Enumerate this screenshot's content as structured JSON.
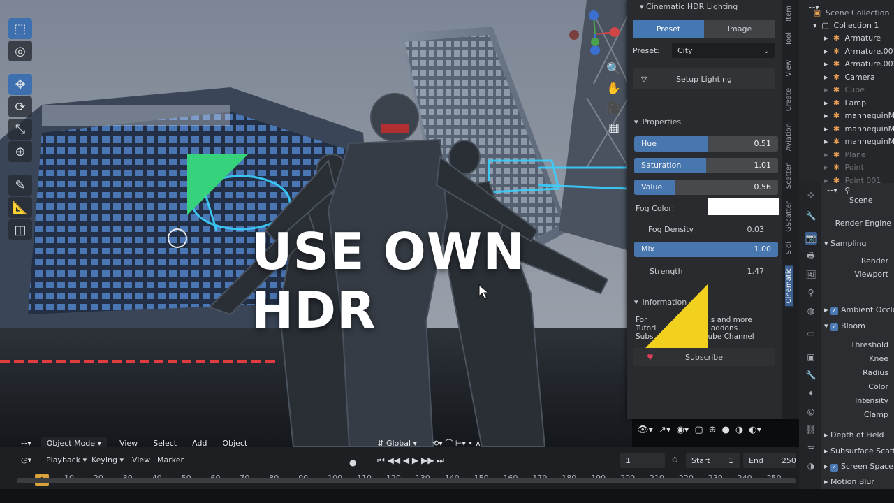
{
  "overlay_title": "USE OWN HDR",
  "viewport": {
    "mode": "Object Mode",
    "menus": [
      "View",
      "Select",
      "Add",
      "Object"
    ],
    "transform_orientation": "Global"
  },
  "npanel": {
    "title": "Cinematic HDR Lighting",
    "tabs": [
      "Preset",
      "Image"
    ],
    "active_tab": "Preset",
    "preset_label": "Preset:",
    "preset_value": "City",
    "setup_button": "Setup Lighting",
    "properties_header": "Properties",
    "sliders": [
      {
        "label": "Hue",
        "value": "0.51",
        "fraction": 0.51
      },
      {
        "label": "Saturation",
        "value": "1.01",
        "fraction": 0.505
      },
      {
        "label": "Value",
        "value": "0.56",
        "fraction": 0.28
      }
    ],
    "fog_color_label": "Fog Color:",
    "fog_color": "#ffffff",
    "fog_density_label": "Fog Density",
    "fog_density_value": "0.03",
    "mix_label": "Mix",
    "mix_value": "1.00",
    "strength_label": "Strength",
    "strength_value": "1.47",
    "information_header": "Information",
    "info_line1": "For Tutori",
    "info_line1b": "s and more addons",
    "info_line2": "Subs",
    "info_line2b": "ube Channel",
    "subscribe_button": "Subscribe"
  },
  "tabstrip": [
    "Item",
    "Tool",
    "View",
    "Create",
    "Aviation",
    "Scatter",
    "GScatter",
    "Sidi",
    "Cinematic"
  ],
  "outliner": {
    "header": "Scene Collection",
    "collection": "Collection 1",
    "items": [
      {
        "name": "Armature",
        "dim": false
      },
      {
        "name": "Armature.001",
        "dim": false
      },
      {
        "name": "Armature.002",
        "dim": false
      },
      {
        "name": "Camera",
        "dim": false
      },
      {
        "name": "Cube",
        "dim": true
      },
      {
        "name": "Lamp",
        "dim": false
      },
      {
        "name": "mannequinM",
        "dim": false
      },
      {
        "name": "mannequinM",
        "dim": false
      },
      {
        "name": "mannequinM",
        "dim": false
      },
      {
        "name": "Plane",
        "dim": true
      },
      {
        "name": "Point",
        "dim": true
      },
      {
        "name": "Point.001",
        "dim": true
      }
    ]
  },
  "properties": {
    "scene_label": "Scene",
    "render_engine": "Render Engine",
    "sampling": "Sampling",
    "render": "Render",
    "viewport": "Viewport",
    "ambient_occlusion": "Ambient Occlus",
    "bloom": "Bloom",
    "bloom_fields": [
      "Threshold",
      "Knee",
      "Radius",
      "Color",
      "Intensity",
      "Clamp"
    ],
    "depth_of_field": "Depth of Field",
    "subsurface": "Subsurface Scatte",
    "screen_space": "Screen Space",
    "motion_blur": "Motion Blur"
  },
  "timeline": {
    "menus": [
      "Playback",
      "Keying",
      "View",
      "Marker"
    ],
    "current_frame": "1",
    "start_label": "Start",
    "start_value": "1",
    "end_label": "End",
    "end_value": "250",
    "cursor_frame": "1",
    "ticks": [
      "10",
      "20",
      "30",
      "40",
      "50",
      "60",
      "70",
      "80",
      "90",
      "100",
      "110",
      "120",
      "130",
      "140",
      "150",
      "160",
      "170",
      "180",
      "190",
      "200",
      "210",
      "220",
      "230",
      "240",
      "250"
    ]
  }
}
